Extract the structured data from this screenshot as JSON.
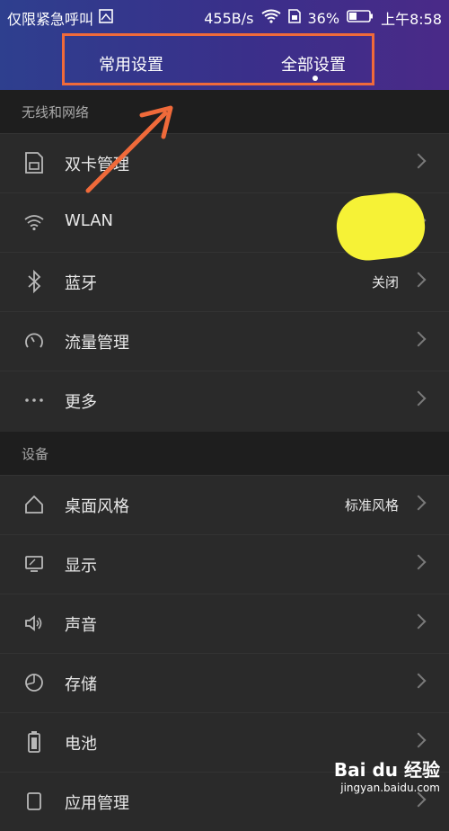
{
  "status_bar": {
    "carrier": "仅限紧急呼叫",
    "speed": "455B/s",
    "battery": "36%",
    "time": "上午8:58"
  },
  "tabs": {
    "left": "常用设置",
    "right": "全部设置"
  },
  "sections": [
    {
      "title": "无线和网络",
      "items": [
        {
          "label": "双卡管理",
          "value": "",
          "icon": "sim-card-icon"
        },
        {
          "label": "WLAN",
          "value": "",
          "icon": "wifi-icon"
        },
        {
          "label": "蓝牙",
          "value": "关闭",
          "icon": "bluetooth-icon"
        },
        {
          "label": "流量管理",
          "value": "",
          "icon": "data-usage-icon"
        },
        {
          "label": "更多",
          "value": "",
          "icon": "more-icon"
        }
      ]
    },
    {
      "title": "设备",
      "items": [
        {
          "label": "桌面风格",
          "value": "标准风格",
          "icon": "home-icon"
        },
        {
          "label": "显示",
          "value": "",
          "icon": "display-icon"
        },
        {
          "label": "声音",
          "value": "",
          "icon": "sound-icon"
        },
        {
          "label": "存储",
          "value": "",
          "icon": "storage-icon"
        },
        {
          "label": "电池",
          "value": "",
          "icon": "battery-icon"
        },
        {
          "label": "应用管理",
          "value": "",
          "icon": "apps-icon"
        }
      ]
    }
  ],
  "watermark": {
    "brand": "Bai du 经验",
    "url": "jingyan.baidu.com"
  },
  "colors": {
    "highlight": "#f06a3a",
    "marker": "#f6f236"
  }
}
